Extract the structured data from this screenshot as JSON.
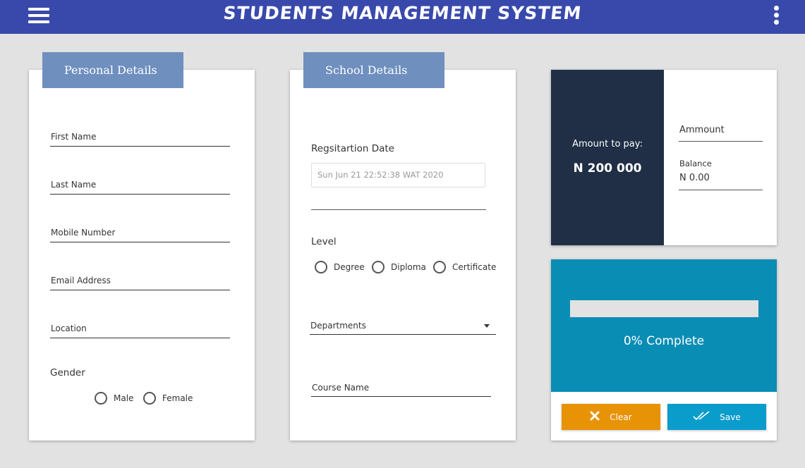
{
  "app": {
    "title": "STUDENTS MANAGEMENT SYSTEM"
  },
  "personal": {
    "tab": "Personal Details",
    "fields": {
      "first_name": "First Name",
      "last_name": "Last Name",
      "mobile": "Mobile Number",
      "email": "Email Address",
      "location": "Location"
    },
    "gender_label": "Gender",
    "gender_options": {
      "male": "Male",
      "female": "Female"
    }
  },
  "school": {
    "tab": "School Details",
    "reg_date_label": "Regsitartion Date",
    "reg_date_value": "Sun Jun 21 22:52:38 WAT 2020",
    "level_label": "Level",
    "level_options": {
      "degree": "Degree",
      "diploma": "Diploma",
      "certificate": "Certificate"
    },
    "departments_label": "Departments",
    "course_label": "Course Name"
  },
  "payment": {
    "amount_label": "Amount to pay:",
    "amount_value": "N 200 000",
    "amount_field_label": "Ammount",
    "balance_label": "Balance",
    "balance_value": "N 0.00"
  },
  "progress": {
    "percent": 0,
    "text": "0% Complete"
  },
  "actions": {
    "clear": "Clear",
    "save": "Save"
  },
  "colors": {
    "topbar": "#3949ab",
    "tab": "#6f8fbf",
    "dark_panel": "#202f46",
    "progress_panel": "#0a8db5",
    "clear_button": "#e89205",
    "save_button": "#0a9ccb"
  },
  "icons": {
    "menu": "hamburger-icon",
    "more": "more-vert-icon",
    "clear": "close-icon",
    "save": "double-check-icon"
  }
}
